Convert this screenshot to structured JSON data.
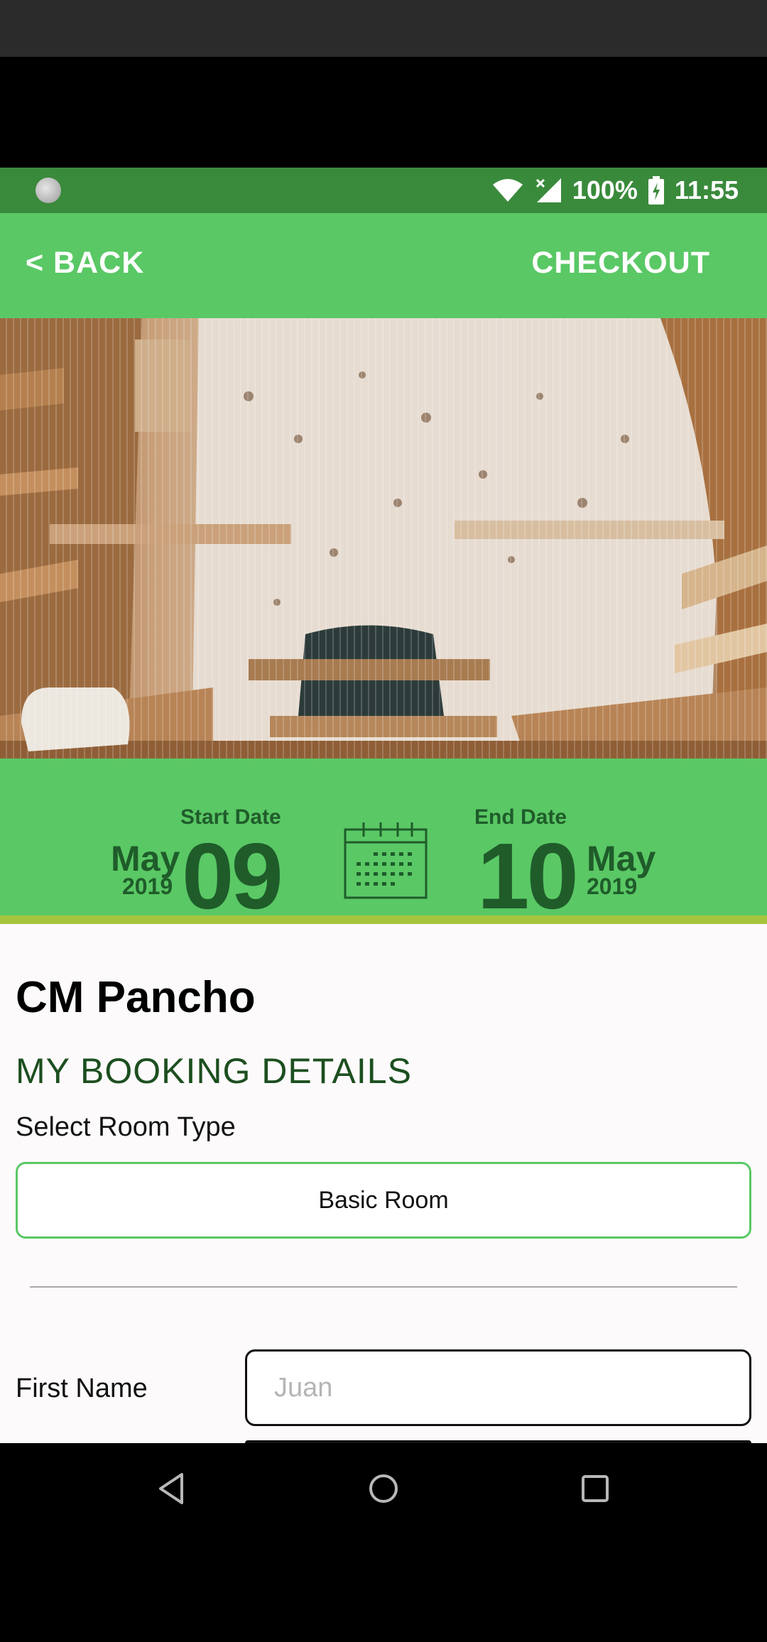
{
  "status_bar": {
    "battery": "100%",
    "time": "11:55"
  },
  "header": {
    "back_label": "< BACK",
    "checkout_label": "CHECKOUT"
  },
  "dates": {
    "start": {
      "label": "Start Date",
      "month": "May",
      "year": "2019",
      "day": "09"
    },
    "end": {
      "label": "End Date",
      "month": "May",
      "year": "2019",
      "day": "10"
    }
  },
  "booking": {
    "hotel_name": "CM Pancho",
    "section_title": "MY BOOKING DETAILS",
    "room_type_label": "Select Room Type",
    "room_type_value": "Basic Room",
    "first_name_label": "First Name",
    "first_name_placeholder": "Juan"
  },
  "colors": {
    "status_green": "#3a8a3c",
    "header_green": "#5ac865",
    "date_text": "#1f5c2a",
    "accent_line": "#a6c53c"
  },
  "icons": [
    "wifi-icon",
    "signal-icon",
    "battery-icon",
    "calendar-icon",
    "nav-back-icon",
    "nav-home-icon",
    "nav-recents-icon"
  ]
}
